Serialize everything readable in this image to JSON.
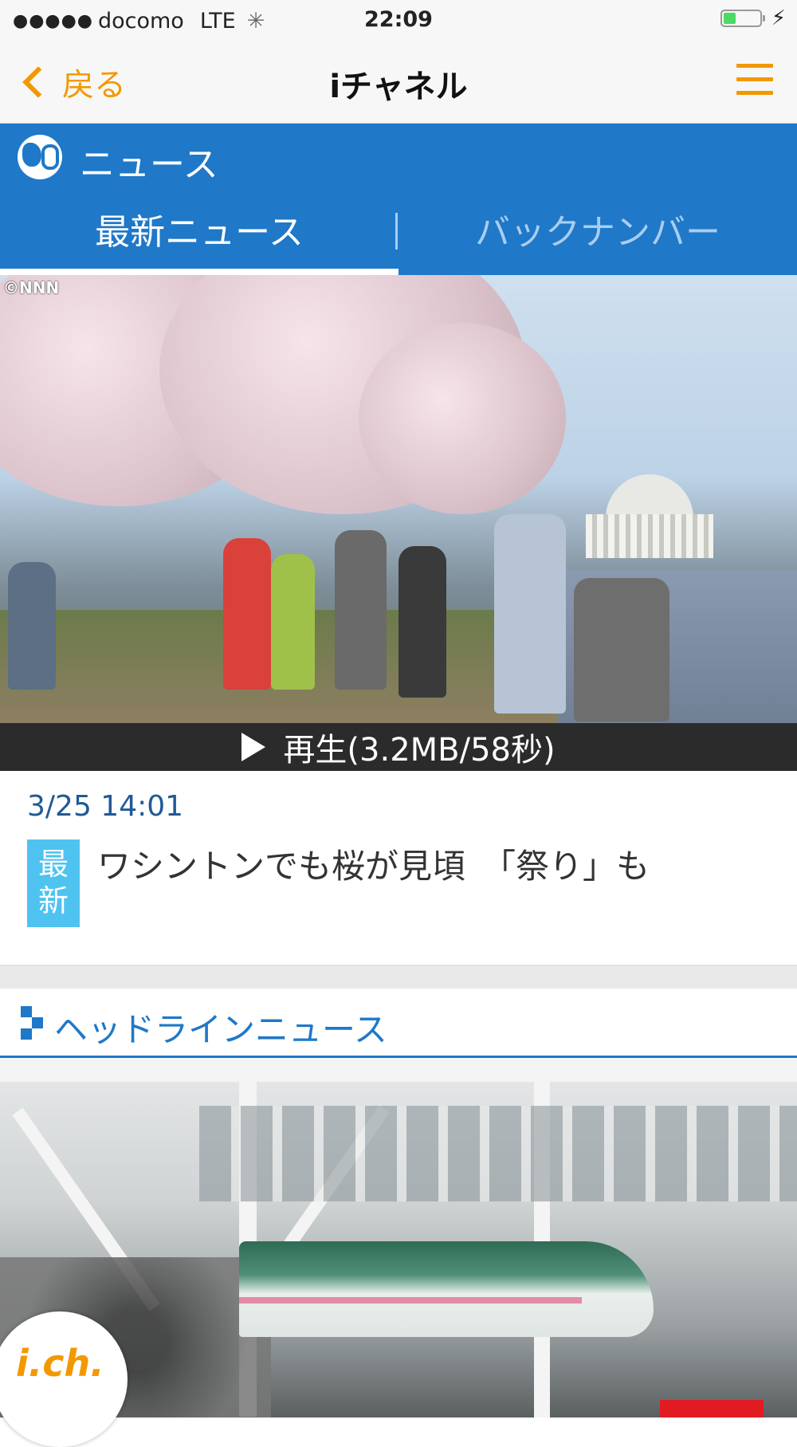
{
  "status_bar": {
    "signal_dots": "●●●●●",
    "carrier": "docomo",
    "network": "LTE",
    "activity_icon": "✳",
    "time": "22:09",
    "battery_level": 0.35,
    "charging_icon": "⚡"
  },
  "nav": {
    "back_label": "戻る",
    "title": "iチャネル",
    "menu_icon": "hamburger-menu-icon",
    "accent_color": "#f39800"
  },
  "news": {
    "section_title": "ニュース",
    "tabs": [
      {
        "label": "最新ニュース",
        "active": true
      },
      {
        "label": "バックナンバー",
        "active": false
      }
    ],
    "header_color": "#1f78c8"
  },
  "featured": {
    "image_credit": "©NNN",
    "play_label": "再生(3.2MB/58秒)",
    "date": "3/25 14:01",
    "badge": "最新",
    "headline": "ワシントンでも桜が見頃　「祭り」も"
  },
  "headlines": {
    "section_label": "ヘッドラインニュース"
  },
  "floating_button": {
    "logo_text": "i.ch."
  }
}
